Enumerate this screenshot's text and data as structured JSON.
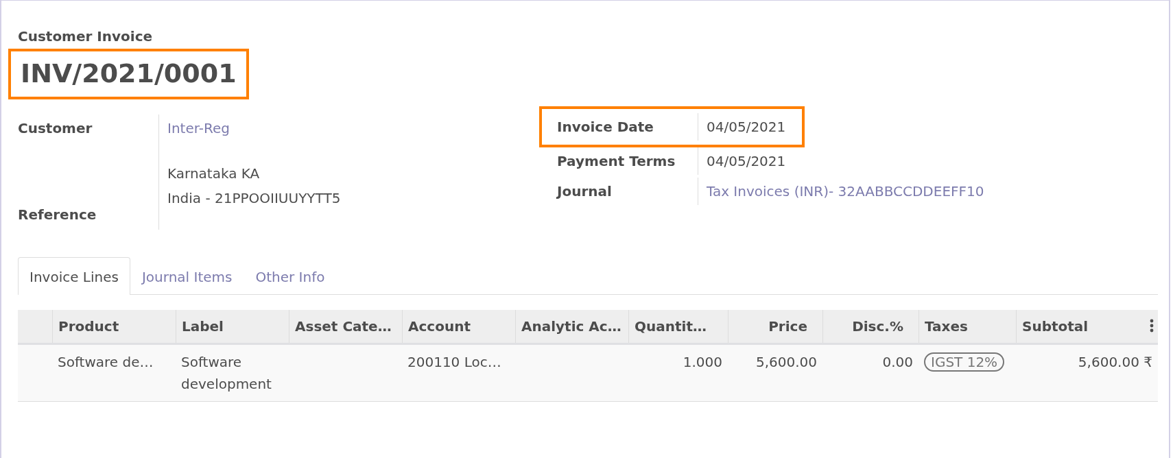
{
  "record_type": "Customer Invoice",
  "number": {
    "text": "INV/2021/0001",
    "highlighted": true
  },
  "left_fields": [
    {
      "label": "Customer",
      "link": "Inter-Reg",
      "address": [
        "Karnataka KA",
        "India - 21PPOOIIUUYYTT5"
      ]
    },
    {
      "label": "Reference"
    }
  ],
  "right_fields": [
    {
      "label": "Invoice Date",
      "kind": "text",
      "value": "04/05/2021",
      "highlighted": true
    },
    {
      "label": "Payment Terms",
      "kind": "text",
      "value": "04/05/2021",
      "highlighted": false
    },
    {
      "label": "Journal",
      "kind": "link",
      "value": "Tax Invoices (INR)- 32AABBCCDDEEFF10",
      "highlighted": false
    }
  ],
  "tabs": [
    {
      "label": "Invoice Lines",
      "selected": true
    },
    {
      "label": "Journal Items",
      "selected": false
    },
    {
      "label": "Other Info",
      "selected": false
    }
  ],
  "table": {
    "columns": [
      {
        "label": "Product"
      },
      {
        "label": "Label"
      },
      {
        "label": "Asset Cate…"
      },
      {
        "label": "Account"
      },
      {
        "label": "Analytic Ac…"
      },
      {
        "label": "Quantit…"
      },
      {
        "label": "Price"
      },
      {
        "label": "Disc.%"
      },
      {
        "label": "Taxes"
      },
      {
        "label": "Subtotal"
      }
    ],
    "rows": [
      {
        "cells": [
          {
            "kind": "text",
            "text": "Software de…"
          },
          {
            "kind": "text",
            "text": "Software development"
          },
          {
            "kind": "text",
            "text": ""
          },
          {
            "kind": "text",
            "text": "200110 Loc…"
          },
          {
            "kind": "text",
            "text": ""
          },
          {
            "kind": "number",
            "text": "1.000"
          },
          {
            "kind": "number",
            "text": "5,600.00"
          },
          {
            "kind": "number",
            "text": "0.00"
          },
          {
            "kind": "tag",
            "text": "IGST 12%"
          },
          {
            "kind": "number",
            "text": "5,600.00 ₹"
          }
        ]
      }
    ]
  }
}
